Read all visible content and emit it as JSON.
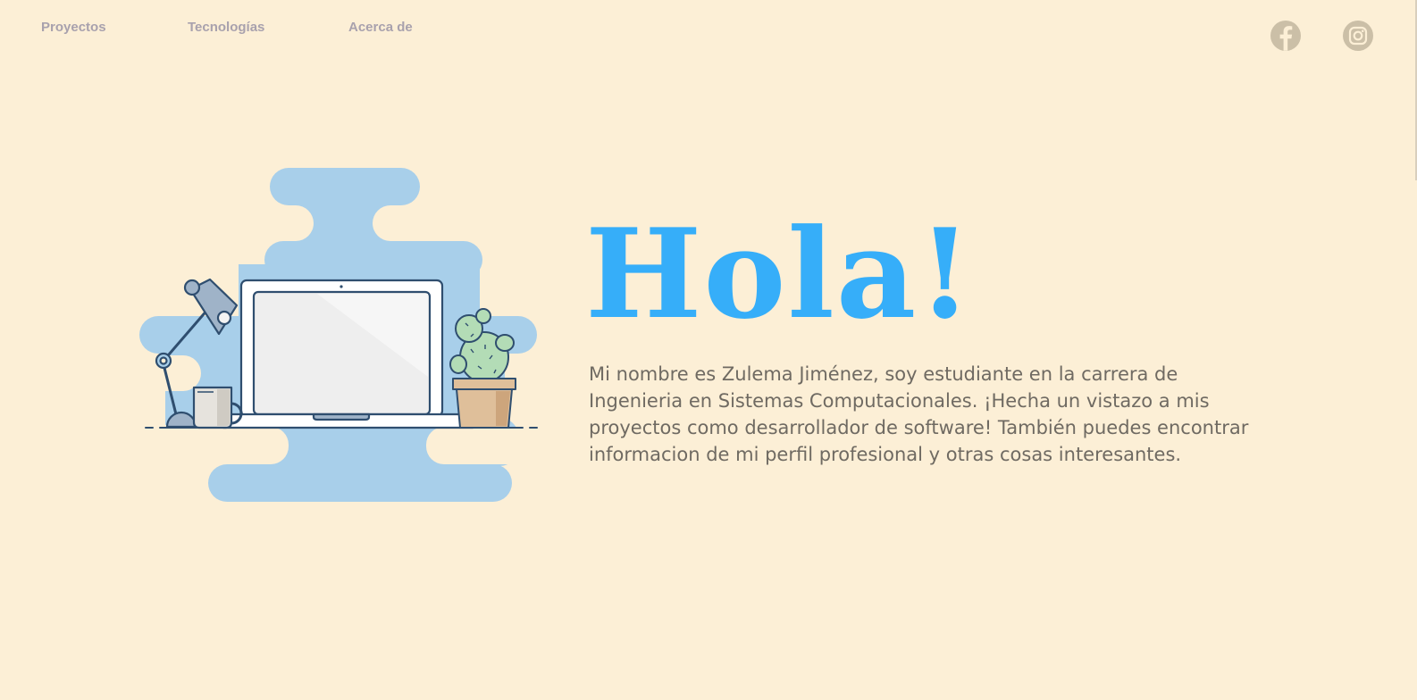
{
  "nav": {
    "items": [
      {
        "label": "Proyectos"
      },
      {
        "label": "Tecnologías"
      },
      {
        "label": "Acerca de"
      }
    ]
  },
  "social": {
    "facebook_icon": "facebook-icon",
    "instagram_icon": "instagram-icon",
    "icon_color": "#cbbfa7"
  },
  "hero": {
    "title": "Hola!",
    "description": "Mi nombre es Zulema Jiménez, soy estudiante en la carrera de Ingenieria en Sistemas Computacionales. ¡Hecha un vistazo a mis proyectos como desarrollador de software! También puedes encontrar informacion de mi perfil profesional y otras cosas interesantes."
  },
  "colors": {
    "background": "#fcefd6",
    "accent": "#36aef9",
    "nav_text": "#a8a1ad",
    "body_text": "#6f6a62"
  }
}
